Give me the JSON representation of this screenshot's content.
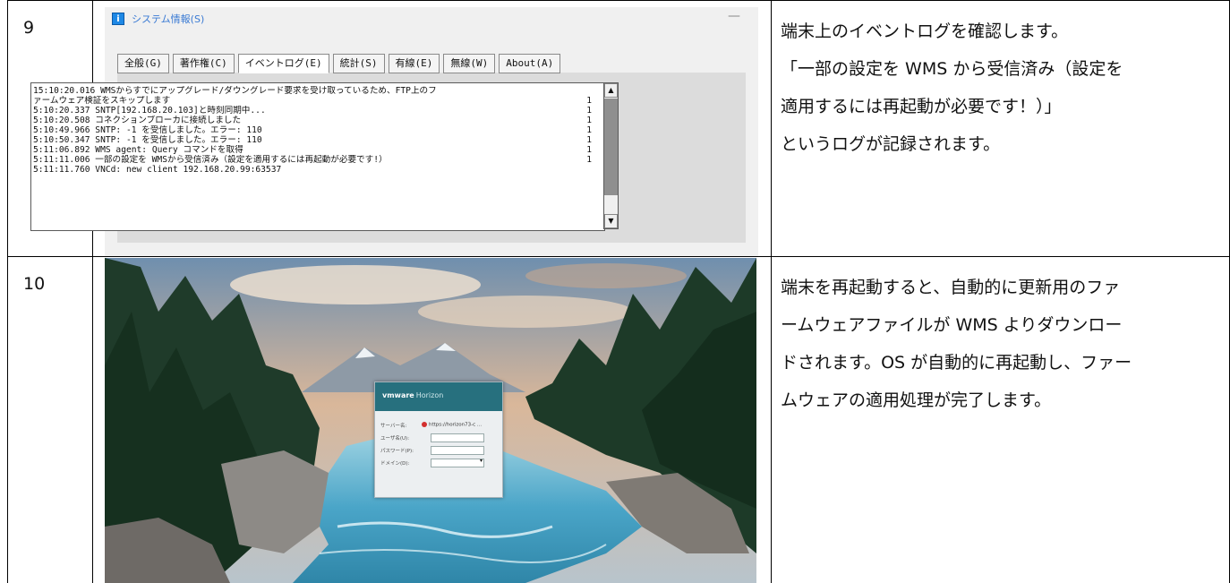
{
  "rows": [
    {
      "number": "9",
      "description": [
        "端末上のイベントログを確認します。",
        "「一部の設定を WMS から受信済み（設定を",
        "適用するには再起動が必要です！）」",
        "というログが記録されます。"
      ]
    },
    {
      "number": "10",
      "description": [
        "端末を再起動すると、自動的に更新用のファ",
        "ームウェアファイルが WMS よりダウンロー",
        "ドされます。OS が自動的に再起動し、ファー",
        "ムウェアの適用処理が完了します。"
      ]
    }
  ],
  "dialog": {
    "icon": "info-icon",
    "title": "システム情報(S)",
    "minimize": "—",
    "tabs": [
      "全般(G)",
      "著作権(C)",
      "イベントログ(E)",
      "統計(S)",
      "有線(E)",
      "無線(W)",
      "About(A)"
    ],
    "active_tab": "イベントログ(E)",
    "log_lines": [
      {
        "text": "15:10:20.016 WMSからすでにアップグレード/ダウングレード要求を受け取っているため、FTP上のフ",
        "count": ""
      },
      {
        "text": "ァームウェア検証をスキップします",
        "count": "1"
      },
      {
        "text": "5:10:20.337 SNTP[192.168.20.103]と時刻同期中...",
        "count": "1"
      },
      {
        "text": "5:10:20.508 コネクションブローカに接続しました",
        "count": "1"
      },
      {
        "text": "5:10:49.966 SNTP: -1 を受信しました。エラー: 110",
        "count": "1"
      },
      {
        "text": "5:10:50.347 SNTP: -1 を受信しました。エラー: 110",
        "count": "1"
      },
      {
        "text": "5:11:06.892 WMS agent: Query コマンドを取得",
        "count": "1"
      },
      {
        "text": "5:11:11.006 一部の設定を WMSから受信済み（設定を適用するには再起動が必要です!）",
        "count": "1"
      },
      {
        "text": "5:11:11.760 VNCd: new client 192.168.20.99:63537",
        "count": ""
      }
    ]
  },
  "login": {
    "brand": "vmware",
    "product": "Horizon",
    "server_label": "サーバー名:",
    "server_value": "https://horizon73-c ...",
    "user_label": "ユーザ名(U):",
    "password_label": "パスワード(P):",
    "domain_label": "ドメイン(D):"
  },
  "colors": {
    "border": "#000000",
    "dialog_title": "#3b7bd4",
    "login_header": "#27707e",
    "river": "#4aa5c8"
  }
}
